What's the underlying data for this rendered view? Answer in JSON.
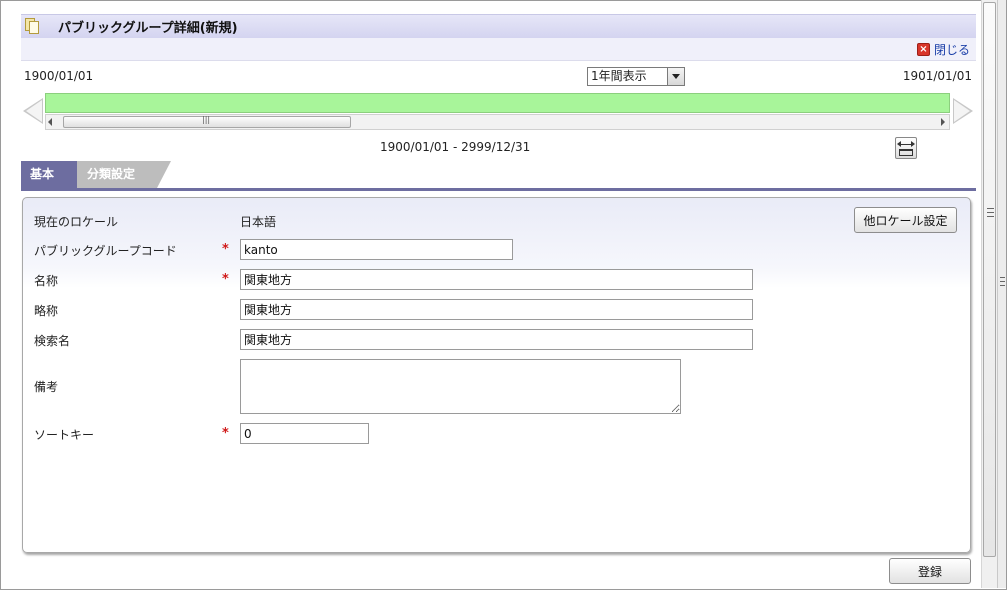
{
  "header": {
    "title": "パブリックグループ詳細(新規)",
    "close_label": "閉じる"
  },
  "timeline": {
    "start_date": "1900/01/01",
    "end_date": "1901/01/01",
    "range_option": "1年間表示",
    "period": "1900/01/01 - 2999/12/31",
    "bar_color": "#a8f59a"
  },
  "tabs": [
    {
      "label": "基本",
      "active": true
    },
    {
      "label": "分類設定",
      "active": false
    }
  ],
  "form": {
    "locale_label": "現在のロケール",
    "locale_value": "日本語",
    "locale_button": "他ロケール設定",
    "required_mark": "*",
    "fields": {
      "group_code": {
        "label": "パブリックグループコード",
        "value": "kanto"
      },
      "name": {
        "label": "名称",
        "value": "関東地方"
      },
      "short_name": {
        "label": "略称",
        "value": "関東地方"
      },
      "search_name": {
        "label": "検索名",
        "value": "関東地方"
      },
      "remarks": {
        "label": "備考",
        "value": ""
      },
      "sort_key": {
        "label": "ソートキー",
        "value": "0"
      }
    }
  },
  "footer": {
    "submit_label": "登録"
  }
}
